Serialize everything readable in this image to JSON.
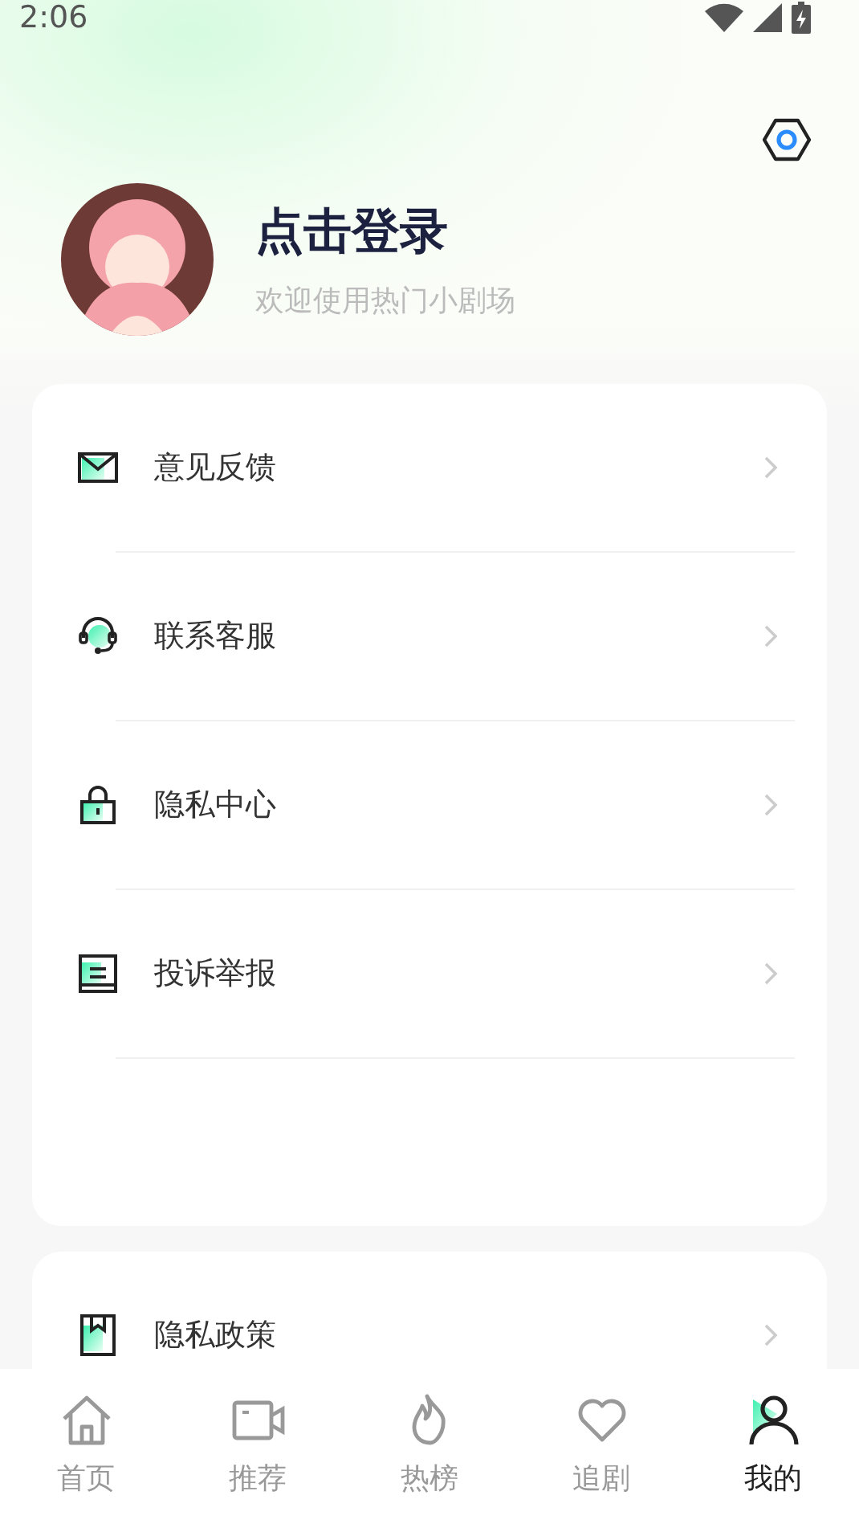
{
  "status_bar": {
    "time": "2:06"
  },
  "profile": {
    "title": "点击登录",
    "subtitle": "欢迎使用热门小剧场"
  },
  "menu_groups": [
    {
      "items": [
        {
          "label": "意见反馈",
          "kind": "mail"
        },
        {
          "label": "联系客服",
          "kind": "headset"
        },
        {
          "label": "隐私中心",
          "kind": "lock"
        },
        {
          "label": "投诉举报",
          "kind": "report"
        }
      ]
    },
    {
      "items": [
        {
          "label": "隐私政策",
          "kind": "policy"
        }
      ]
    }
  ],
  "tabs": [
    {
      "label": "首页",
      "kind": "home",
      "selected": false
    },
    {
      "label": "推荐",
      "kind": "video",
      "selected": false
    },
    {
      "label": "热榜",
      "kind": "flame",
      "selected": false
    },
    {
      "label": "追剧",
      "kind": "heart",
      "selected": false
    },
    {
      "label": "我的",
      "kind": "user",
      "selected": true
    }
  ]
}
